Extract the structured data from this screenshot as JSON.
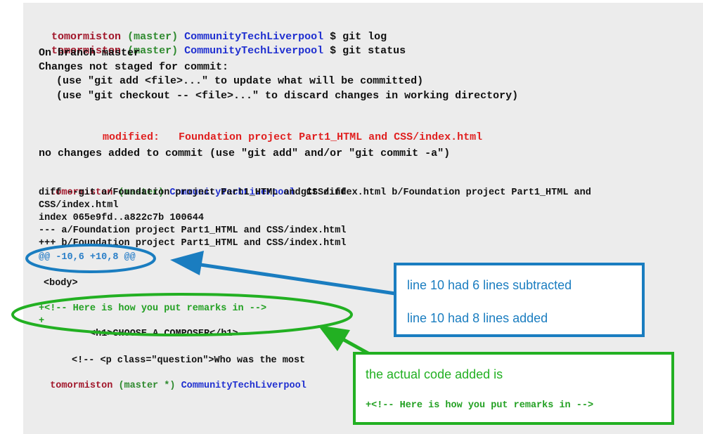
{
  "terminal": {
    "prompt1": {
      "user": "tomormiston",
      "branch": "(master)",
      "repo": "CommunityTechLiverpool",
      "cmd": "$ git log"
    },
    "prompt2": {
      "user": "tomormiston",
      "branch": "(master)",
      "repo": "CommunityTechLiverpool",
      "cmd": "$ git status"
    },
    "on_branch": "On branch master",
    "changes_not_staged": "Changes not staged for commit:",
    "hint_add": "(use \"git add <file>...\" to update what will be committed)",
    "hint_checkout": "(use \"git checkout -- <file>...\" to discard changes in working directory)",
    "modified_label": "modified:",
    "modified_file": "Foundation project Part1_HTML and CSS/index.html",
    "no_changes": "no changes added to commit (use \"git add\" and/or \"git commit -a\")",
    "prompt3": {
      "user": "tomormiston",
      "branch": "(master)",
      "repo": "CommunityTechLiverpool",
      "cmd": "git diff"
    },
    "diff_header_1": "diff --git a/Foundation project Part1_HTML and CSS/index.html b/Foundation project Part1_HTML and",
    "diff_header_2": "CSS/index.html",
    "index_line": "index 065e9fd..a822c7b 100644",
    "minus_file": "--- a/Foundation project Part1_HTML and CSS/index.html",
    "plus_file": "+++ b/Foundation project Part1_HTML and CSS/index.html",
    "hunk": "@@ -10,6 +10,8 @@",
    "body_tag": "<body>",
    "added_remark": "+<!-- Here is how you put remarks in -->",
    "added_blank": "+",
    "h1_line": "<h1>CHOOSE A COMPOSER</h1>",
    "question_line": "<!-- <p class=\"question\">Who was the most",
    "prompt4": {
      "user": "tomormiston",
      "branch": "(master *)",
      "repo": "CommunityTechLiverpool"
    }
  },
  "callouts": {
    "blue": {
      "line1": "line 10 had 6 lines subtracted",
      "line2": "line 10 had 8 lines added",
      "color": "#1a7dc0"
    },
    "green": {
      "line1": "the actual code added is",
      "code": "+<!-- Here is how you put remarks in -->",
      "color": "#22b022"
    }
  }
}
